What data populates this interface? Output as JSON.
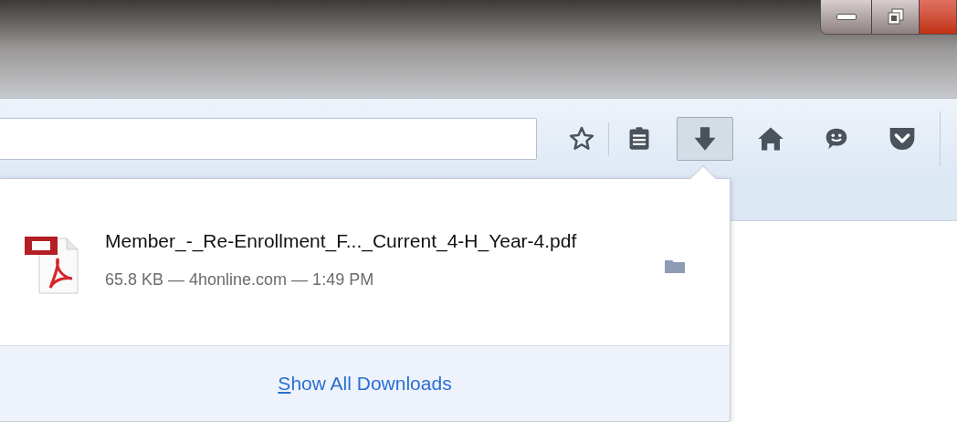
{
  "toolbar": {
    "buttons": [
      {
        "kind": "star",
        "selected": false
      },
      {
        "kind": "reading-list",
        "selected": false
      },
      {
        "kind": "download",
        "selected": true
      },
      {
        "kind": "home",
        "selected": false
      },
      {
        "kind": "chat",
        "selected": false
      },
      {
        "kind": "pocket",
        "selected": false
      }
    ]
  },
  "downloads_panel": {
    "items": [
      {
        "file_name": "Member_-_Re-Enrollment_F..._Current_4-H_Year-4.pdf",
        "details": "65.8 KB — 4honline.com — 1:49 PM"
      }
    ],
    "footer_link": {
      "access_key": "S",
      "label_rest": "how All Downloads"
    }
  }
}
